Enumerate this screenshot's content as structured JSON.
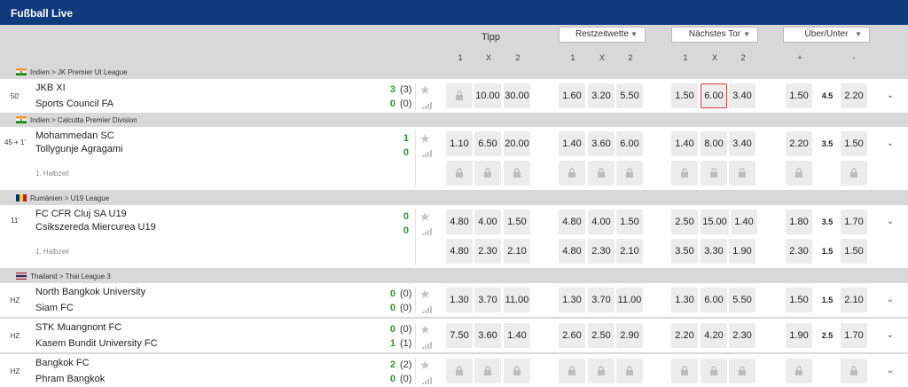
{
  "title": "Fußball Live",
  "header": {
    "tipp": "Tipp",
    "restzeit": "Restzeitwette",
    "naechstes": "Nächstes Tor",
    "ueberunter": "Über/Unter",
    "cols": [
      "1",
      "X",
      "2",
      "1",
      "X",
      "2",
      "1",
      "X",
      "2",
      "+",
      "-"
    ]
  },
  "leagues": [
    {
      "flag": "india",
      "label": "Indien > JK Premier Ut League"
    },
    {
      "flag": "india",
      "label": "Indien > Calcutta Premier Division"
    },
    {
      "flag": "romania",
      "label": "Rumänien > U19 League"
    },
    {
      "flag": "thailand",
      "label": "Thailand > Thai League 3"
    }
  ],
  "matches": [
    {
      "time": "50'",
      "home": "JKB XI",
      "away": "Sports Council FA",
      "score_home": "3",
      "score_away": "0",
      "ht_home": "(3)",
      "ht_away": "(0)",
      "sub": "",
      "tipp": [
        "",
        "10.00",
        "30.00"
      ],
      "rest": [
        "1.60",
        "3.20",
        "5.50"
      ],
      "next": [
        "1.50",
        "6.00",
        "3.40"
      ],
      "ou": [
        "1.50",
        "4.5",
        "2.20"
      ],
      "selected": "6.00"
    },
    {
      "time": "45 + 1'",
      "home": "Mohammedan SC",
      "away": "Tollygunje Agragami",
      "score_home": "1",
      "score_away": "0",
      "ht_home": "",
      "ht_away": "",
      "sub": "1. Halbzeit",
      "tipp": [
        "1.10",
        "6.50",
        "20.00"
      ],
      "rest": [
        "1.40",
        "3.60",
        "6.00"
      ],
      "next": [
        "1.40",
        "8.00",
        "3.40"
      ],
      "ou": [
        "2.20",
        "3.5",
        "1.50"
      ]
    },
    {
      "time": "11'",
      "home": "FC CFR Cluj SA U19",
      "away": "Csikszereda Miercurea U19",
      "score_home": "0",
      "score_away": "0",
      "ht_home": "",
      "ht_away": "",
      "sub": "1. Halbzeit",
      "tipp": [
        "4.80",
        "4.00",
        "1.50"
      ],
      "rest": [
        "4.80",
        "4.00",
        "1.50"
      ],
      "next": [
        "2.50",
        "15.00",
        "1.40"
      ],
      "ou": [
        "1.80",
        "3.5",
        "1.70"
      ],
      "tipp2": [
        "4.80",
        "2.30",
        "2.10"
      ],
      "rest2": [
        "4.80",
        "2.30",
        "2.10"
      ],
      "next2": [
        "3.50",
        "3.30",
        "1.90"
      ],
      "ou2": [
        "2.30",
        "1.5",
        "1.50"
      ]
    },
    {
      "time": "HZ",
      "home": "North Bangkok University",
      "away": "Siam FC",
      "score_home": "0",
      "score_away": "0",
      "ht_home": "(0)",
      "ht_away": "(0)",
      "sub": "",
      "tipp": [
        "1.30",
        "3.70",
        "11.00"
      ],
      "rest": [
        "1.30",
        "3.70",
        "11.00"
      ],
      "next": [
        "1.30",
        "6.00",
        "5.50"
      ],
      "ou": [
        "1.50",
        "1.5",
        "2.10"
      ]
    },
    {
      "time": "HZ",
      "home": "STK Muangnont FC",
      "away": "Kasem Bundit University FC",
      "score_home": "0",
      "score_away": "1",
      "ht_home": "(0)",
      "ht_away": "(1)",
      "sub": "",
      "tipp": [
        "7.50",
        "3.60",
        "1.40"
      ],
      "rest": [
        "2.60",
        "2.50",
        "2.90"
      ],
      "next": [
        "2.20",
        "4.20",
        "2.30"
      ],
      "ou": [
        "1.90",
        "2.5",
        "1.70"
      ]
    },
    {
      "time": "HZ",
      "home": "Bangkok FC",
      "away": "Phram Bangkok",
      "score_home": "2",
      "score_away": "0",
      "ht_home": "(2)",
      "ht_away": "(0)",
      "sub": ""
    }
  ]
}
